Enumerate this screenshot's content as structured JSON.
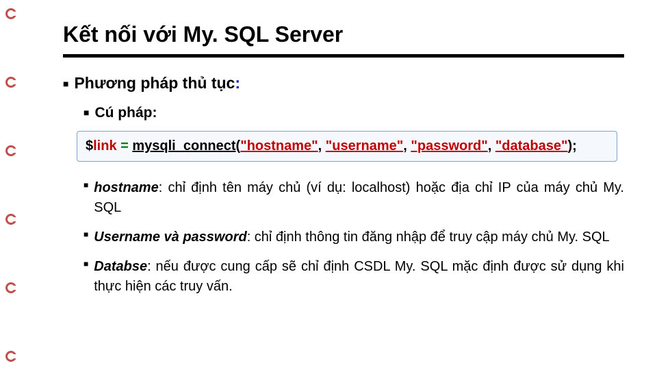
{
  "left_bullet_color_outer": "#c0504d",
  "left_bullet_color_inner": "#ffffff",
  "title": "Kết nối với My. SQL Server",
  "h2_black": "Phương pháp thủ tục",
  "h2_blue": ":",
  "h3": "Cú pháp:",
  "code": {
    "dollar": "$",
    "link": "link",
    "eq": " = ",
    "fn": "mysqli_connect",
    "open": "(",
    "s1": "\"hostname\"",
    "c1": ", ",
    "s2": "\"username\"",
    "c2": ", ",
    "s3": "\"password\"",
    "c3": ", ",
    "s4": "\"database\"",
    "close": ");"
  },
  "desc": [
    {
      "lead": "hostname",
      "body": ": chỉ định tên máy chủ (ví dụ: localhost) hoặc địa chỉ IP của máy chủ My. SQL"
    },
    {
      "lead": "Username và password",
      "body": ": chỉ định thông tin đăng nhập để truy cập máy chủ My. SQL"
    },
    {
      "lead": "Databse",
      "body": ": nếu được cung cấp sẽ chỉ định CSDL My. SQL mặc định được sử dụng khi thực hiện các truy vấn."
    }
  ]
}
